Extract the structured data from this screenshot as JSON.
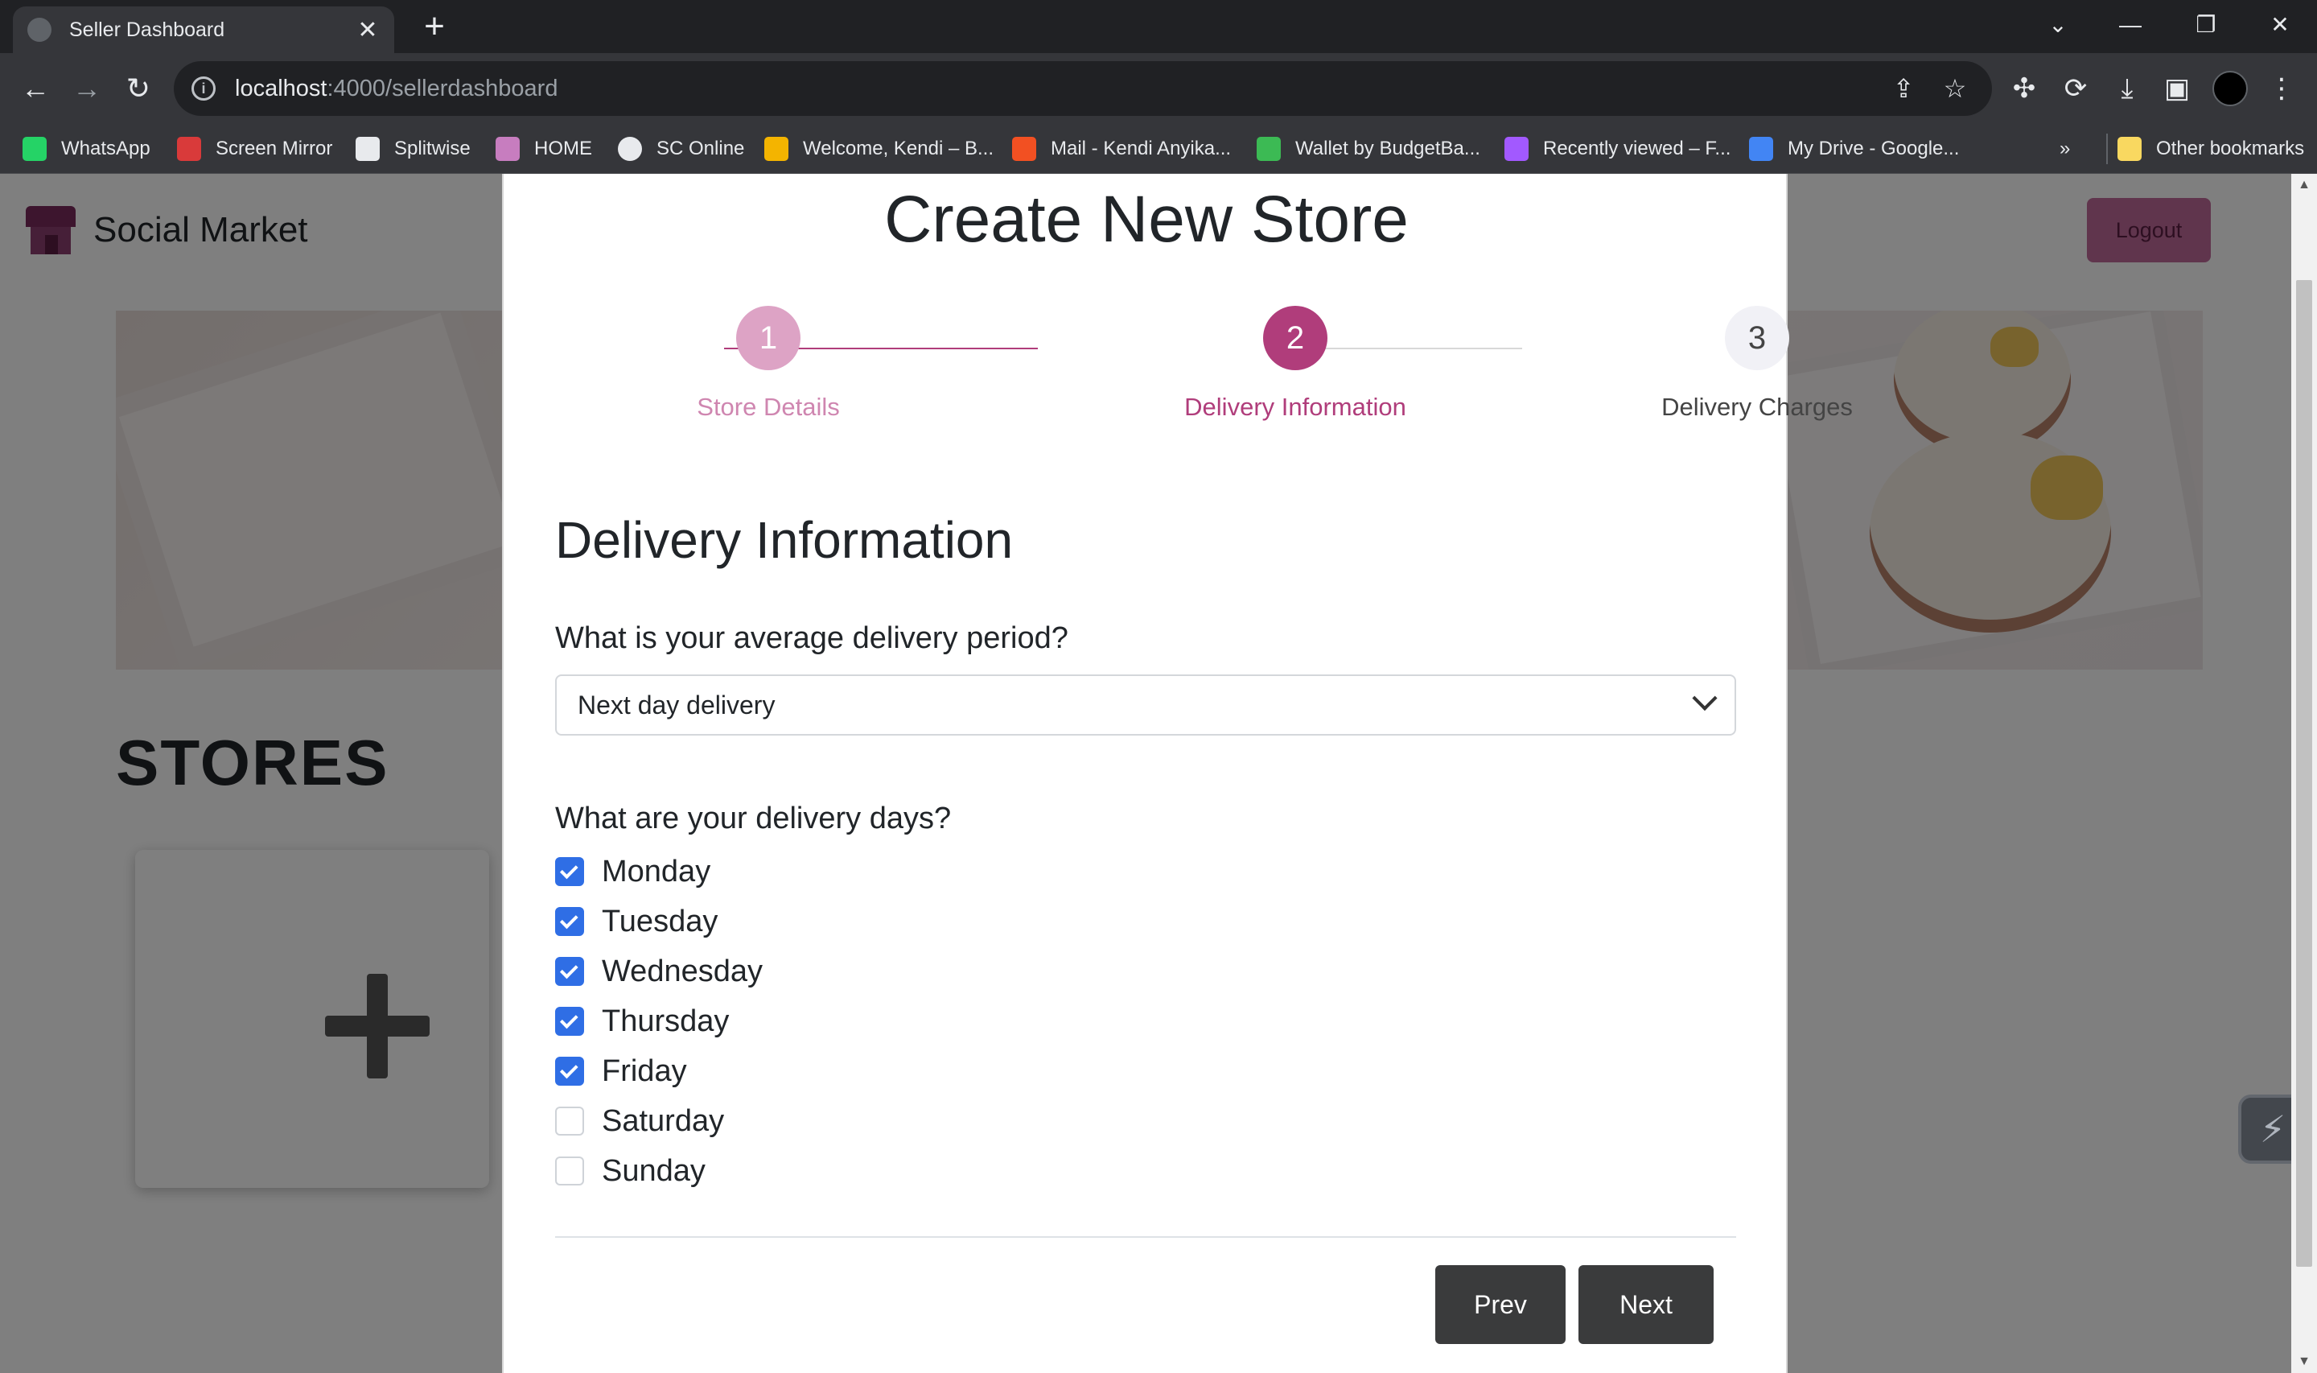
{
  "browser": {
    "tab_title": "Seller Dashboard",
    "url_host": "localhost",
    "url_path": ":4000/sellerdashboard",
    "bookmarks": [
      {
        "label": "WhatsApp",
        "icon": "whatsapp-icon",
        "color": "#25d366"
      },
      {
        "label": "Screen Mirror",
        "icon": "screen-mirror-icon",
        "color": "#d93a3a"
      },
      {
        "label": "Splitwise",
        "icon": "splitwise-icon",
        "color": "#e8eaed"
      },
      {
        "label": "HOME",
        "icon": "home-icon",
        "color": "#c77dbf"
      },
      {
        "label": "SC Online",
        "icon": "globe-icon",
        "color": "#e8eaed"
      },
      {
        "label": "Welcome, Kendi – B...",
        "icon": "chart-bars-icon",
        "color": "#f4b400"
      },
      {
        "label": "Mail - Kendi Anyika...",
        "icon": "microsoft-icon",
        "color": "#f25022"
      },
      {
        "label": "Wallet by BudgetBa...",
        "icon": "wallet-icon",
        "color": "#3cba54"
      },
      {
        "label": "Recently viewed – F...",
        "icon": "figma-icon",
        "color": "#a259ff"
      },
      {
        "label": "My Drive - Google...",
        "icon": "google-drive-icon",
        "color": "#4285f4"
      }
    ],
    "more_bookmarks": "»",
    "other_bookmarks": "Other bookmarks"
  },
  "page": {
    "brand": "Social Market",
    "logout": "Logout",
    "stores_heading": "STORES"
  },
  "modal": {
    "title": "Create New Store",
    "steps": [
      {
        "number": "1",
        "label": "Store Details",
        "state": "completed"
      },
      {
        "number": "2",
        "label": "Delivery Information",
        "state": "active"
      },
      {
        "number": "3",
        "label": "Delivery Charges",
        "state": "pending"
      }
    ],
    "section_title": "Delivery Information",
    "delivery_period_question": "What is your average delivery period?",
    "delivery_period_value": "Next day delivery",
    "delivery_days_question": "What are your delivery days?",
    "days": [
      {
        "label": "Monday",
        "checked": true
      },
      {
        "label": "Tuesday",
        "checked": true
      },
      {
        "label": "Wednesday",
        "checked": true
      },
      {
        "label": "Thursday",
        "checked": true
      },
      {
        "label": "Friday",
        "checked": true
      },
      {
        "label": "Saturday",
        "checked": false
      },
      {
        "label": "Sunday",
        "checked": false
      }
    ],
    "prev_label": "Prev",
    "next_label": "Next"
  },
  "colors": {
    "accent": "#b03d7b",
    "checkbox": "#2f6ee5",
    "button_dark": "#3a3b3c"
  }
}
